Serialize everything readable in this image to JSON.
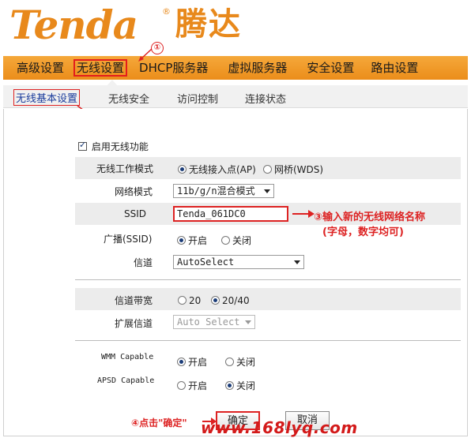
{
  "brand": {
    "logo_en": "Tenda",
    "logo_reg": "®",
    "logo_cn": "腾达"
  },
  "main_nav": {
    "items": [
      "高级设置",
      "无线设置",
      "DHCP服务器",
      "虚拟服务器",
      "安全设置",
      "路由设置"
    ],
    "active_index": 1
  },
  "sub_nav": {
    "items": [
      "无线基本设置",
      "无线安全",
      "访问控制",
      "连接状态"
    ],
    "active_index": 0
  },
  "form": {
    "enable_wireless": {
      "label": "启用无线功能",
      "checked": true
    },
    "work_mode": {
      "label": "无线工作模式",
      "options": [
        "无线接入点(AP)",
        "网桥(WDS)"
      ],
      "selected": "无线接入点(AP)"
    },
    "network_mode": {
      "label": "网络模式",
      "value": "11b/g/n混合模式"
    },
    "ssid": {
      "label": "SSID",
      "value": "Tenda_061DC0"
    },
    "broadcast": {
      "label": "广播(SSID)",
      "options": [
        "开启",
        "关闭"
      ],
      "selected": "开启"
    },
    "channel": {
      "label": "信道",
      "value": "AutoSelect"
    },
    "bandwidth": {
      "label": "信道带宽",
      "options": [
        "20",
        "20/40"
      ],
      "selected": "20/40"
    },
    "ext_channel": {
      "label": "扩展信道",
      "value": "Auto Select",
      "disabled": true
    },
    "wmm": {
      "label": "WMM Capable",
      "options": [
        "开启",
        "关闭"
      ],
      "selected": "开启"
    },
    "apsd": {
      "label": "APSD Capable",
      "options": [
        "开启",
        "关闭"
      ],
      "selected": "关闭"
    },
    "ok_button": "确定",
    "cancel_button": "取消"
  },
  "annotations": {
    "step1": "①",
    "step2": "②",
    "step3_text": "③输入新的无线网络名称",
    "step3_sub": "(字母，数字均可)",
    "step4_text": "④点击\"确定\""
  },
  "watermark": "www.168lyq.com",
  "colors": {
    "nav_orange": "#eb8d1a",
    "logo_orange": "#e8891c",
    "annotation_red": "#d22"
  }
}
